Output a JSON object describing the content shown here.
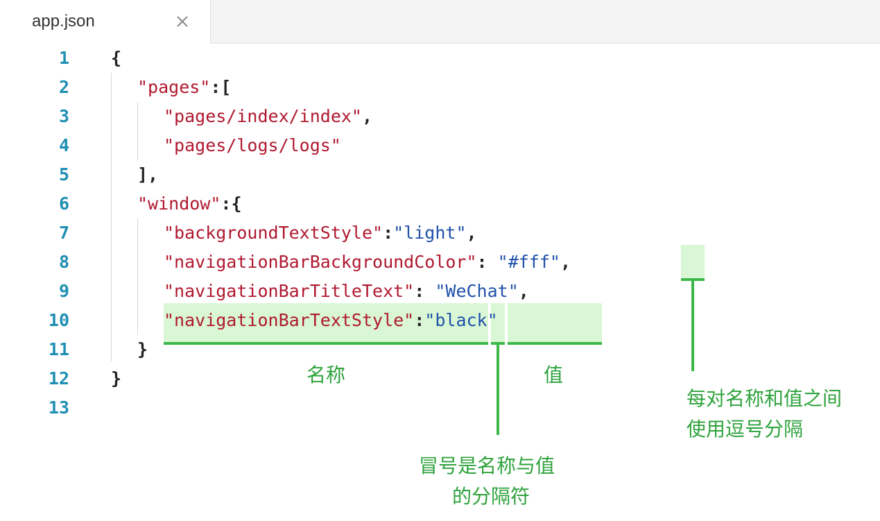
{
  "tab": {
    "label": "app.json",
    "close_glyph": "×"
  },
  "editor": {
    "lines": [
      {
        "num": "1",
        "segments": [
          {
            "t": "{",
            "c": "pun"
          }
        ]
      },
      {
        "num": "2",
        "segments": [
          {
            "t": "\"pages\"",
            "c": "str"
          },
          {
            "t": ":[",
            "c": "pun"
          }
        ]
      },
      {
        "num": "3",
        "segments": [
          {
            "t": "\"pages/index/index\"",
            "c": "str"
          },
          {
            "t": ",",
            "c": "pun"
          }
        ]
      },
      {
        "num": "4",
        "segments": [
          {
            "t": "\"pages/logs/logs\"",
            "c": "str"
          }
        ]
      },
      {
        "num": "5",
        "segments": [
          {
            "t": "],",
            "c": "pun"
          }
        ]
      },
      {
        "num": "6",
        "segments": [
          {
            "t": "\"window\"",
            "c": "str"
          },
          {
            "t": ":{",
            "c": "pun"
          }
        ]
      },
      {
        "num": "7",
        "segments": [
          {
            "t": "\"backgroundTextStyle\"",
            "c": "str"
          },
          {
            "t": ":",
            "c": "pun"
          },
          {
            "t": "\"light\"",
            "c": "val"
          },
          {
            "t": ",",
            "c": "pun"
          }
        ]
      },
      {
        "num": "8",
        "segments": [
          {
            "t": "\"navigationBarBackgroundColor\"",
            "c": "str"
          },
          {
            "t": ": ",
            "c": "pun"
          },
          {
            "t": "\"#fff\"",
            "c": "val"
          },
          {
            "t": ",",
            "c": "pun"
          }
        ]
      },
      {
        "num": "9",
        "segments": [
          {
            "t": "\"navigationBarTitleText\"",
            "c": "str"
          },
          {
            "t": ": ",
            "c": "pun"
          },
          {
            "t": "\"WeChat\"",
            "c": "val"
          },
          {
            "t": ",",
            "c": "pun"
          }
        ]
      },
      {
        "num": "10",
        "segments": [
          {
            "t": "\"navigationBarTextStyle\"",
            "c": "str"
          },
          {
            "t": ":",
            "c": "pun"
          },
          {
            "t": "\"black\"",
            "c": "val"
          }
        ]
      },
      {
        "num": "11",
        "segments": [
          {
            "t": "}",
            "c": "pun"
          }
        ]
      },
      {
        "num": "12",
        "segments": [
          {
            "t": "}",
            "c": "pun"
          }
        ]
      },
      {
        "num": "13",
        "segments": []
      }
    ]
  },
  "annotations": {
    "name_label": "名称",
    "value_label": "值",
    "comma_note_line1": "每对名称和值之间",
    "comma_note_line2": "使用逗号分隔",
    "colon_note_line1": "冒号是名称与值",
    "colon_note_line2": "的分隔符"
  },
  "colors": {
    "line_number": "#1f8fb3",
    "string_key": "#b0182f",
    "string_value": "#1f51a9",
    "annotation_green": "#2ea23c",
    "highlight_bg": "#d9f7d4"
  }
}
